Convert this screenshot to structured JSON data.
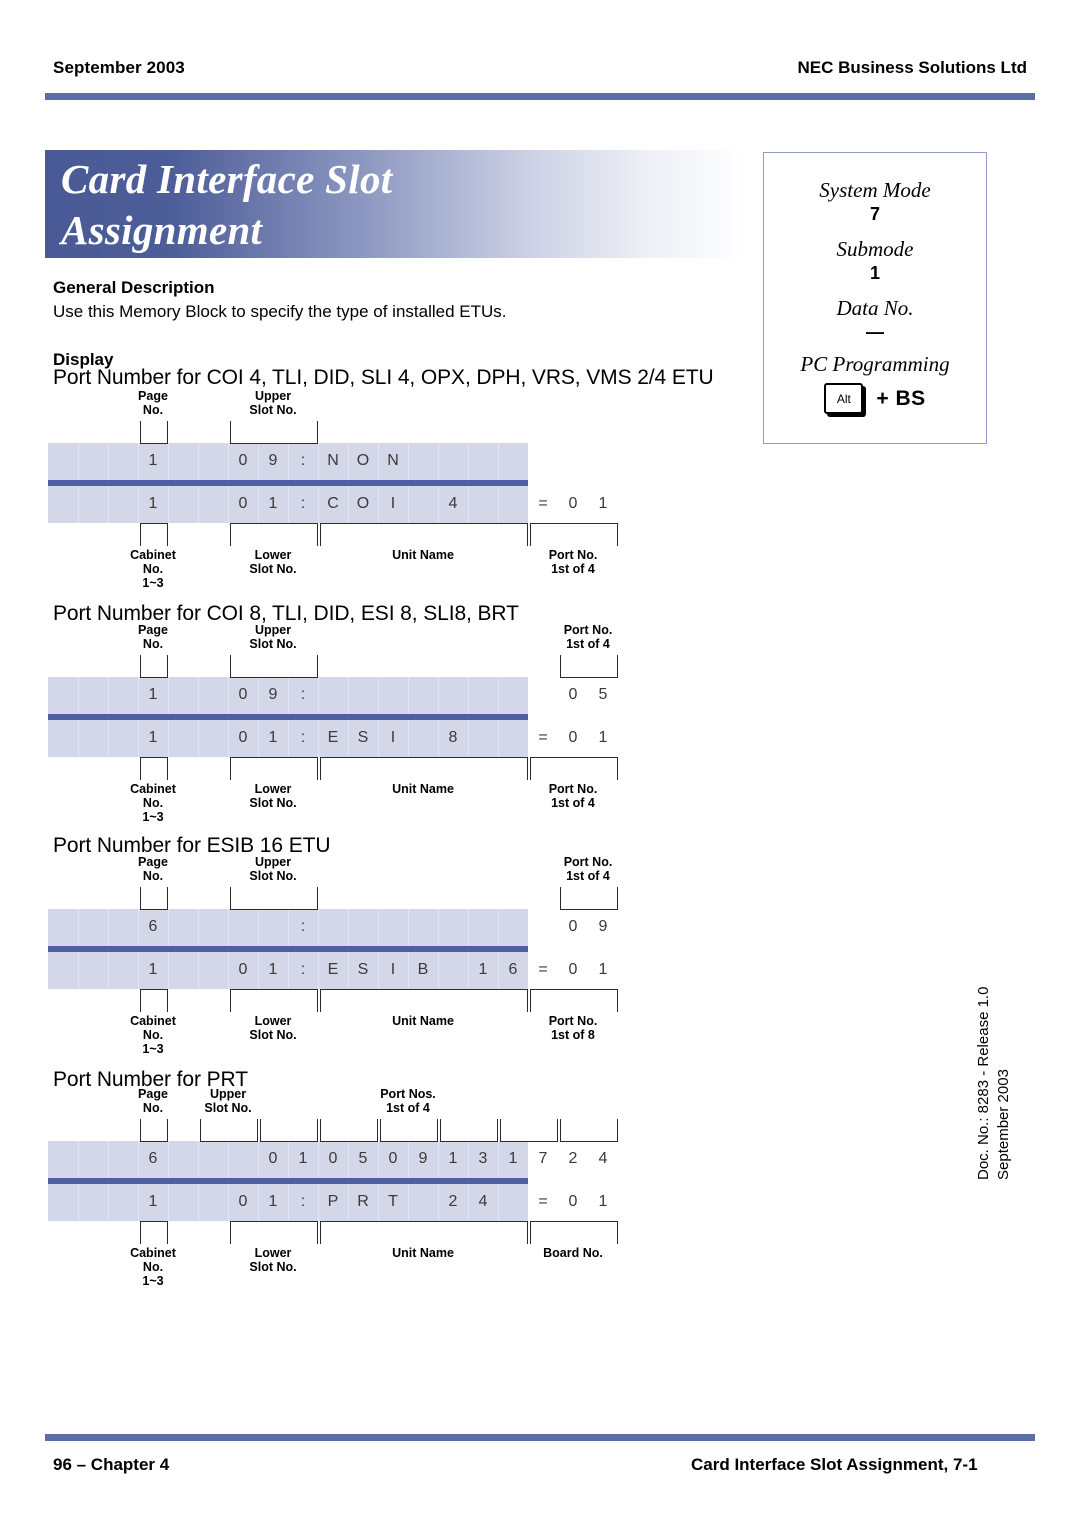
{
  "header": {
    "date": "September 2003",
    "company": "NEC Business Solutions Ltd"
  },
  "footer": {
    "left": "96 – Chapter 4",
    "right": "Card Interface Slot Assignment, 7-1"
  },
  "doc_sidebar": {
    "line1": "Doc. No.: 8283 - Release 1.0",
    "line2": "September 2003"
  },
  "title": {
    "line1": "Card Interface Slot",
    "line2": "Assignment"
  },
  "mode_box": {
    "system_mode_label": "System Mode",
    "system_mode_value": "7",
    "submode_label": "Submode",
    "submode_value": "1",
    "data_no_label": "Data No.",
    "data_no_value": "—",
    "pc_programming_label": "PC Programming",
    "key_label": "Alt",
    "key_combo": "+ BS"
  },
  "general": {
    "heading": "General Description",
    "text": "Use this Memory Block to specify the type of installed ETUs."
  },
  "display": {
    "heading": "Display"
  },
  "labels": {
    "page_no": "Page|No.",
    "upper_slot": "Upper|Slot No.",
    "port_no_1of4": "Port No.|1st of 4",
    "port_no_1of8": "Port No.|1st of 8",
    "port_nos_1of4": "Port Nos.|1st of 4",
    "cabinet_no": "Cabinet|No.|1~3",
    "lower_slot": "Lower|Slot No.",
    "unit_name": "Unit Name",
    "board_no": "Board No."
  },
  "sections": [
    {
      "title": "Port Number for COI 4, TLI, DID, SLI 4, OPX, DPH, VRS, VMS 2/4 ETU",
      "top_row": [
        {
          "c": 3,
          "t": "1"
        },
        {
          "c": 6,
          "t": "0"
        },
        {
          "c": 7,
          "t": "9"
        },
        {
          "c": 8,
          "t": ":"
        },
        {
          "c": 9,
          "t": "N"
        },
        {
          "c": 10,
          "t": "O"
        },
        {
          "c": 11,
          "t": "N"
        }
      ],
      "bottom_row": [
        {
          "c": 3,
          "t": "1"
        },
        {
          "c": 6,
          "t": "0"
        },
        {
          "c": 7,
          "t": "1"
        },
        {
          "c": 8,
          "t": ":"
        },
        {
          "c": 9,
          "t": "C"
        },
        {
          "c": 10,
          "t": "O"
        },
        {
          "c": 11,
          "t": "I"
        },
        {
          "c": 13,
          "t": "4"
        },
        {
          "c": 16,
          "t": "="
        },
        {
          "c": 17,
          "t": "0"
        },
        {
          "c": 18,
          "t": "1"
        }
      ]
    },
    {
      "title": "Port Number for COI 8, TLI, DID, ESI 8, SLI8, BRT",
      "top_row": [
        {
          "c": 3,
          "t": "1"
        },
        {
          "c": 6,
          "t": "0"
        },
        {
          "c": 7,
          "t": "9"
        },
        {
          "c": 8,
          "t": ":"
        },
        {
          "c": 17,
          "t": "0"
        },
        {
          "c": 18,
          "t": "5"
        }
      ],
      "bottom_row": [
        {
          "c": 3,
          "t": "1"
        },
        {
          "c": 6,
          "t": "0"
        },
        {
          "c": 7,
          "t": "1"
        },
        {
          "c": 8,
          "t": ":"
        },
        {
          "c": 9,
          "t": "E"
        },
        {
          "c": 10,
          "t": "S"
        },
        {
          "c": 11,
          "t": "I"
        },
        {
          "c": 13,
          "t": "8"
        },
        {
          "c": 16,
          "t": "="
        },
        {
          "c": 17,
          "t": "0"
        },
        {
          "c": 18,
          "t": "1"
        }
      ]
    },
    {
      "title": "Port Number for ESIB 16 ETU",
      "top_row": [
        {
          "c": 3,
          "t": "6"
        },
        {
          "c": 8,
          "t": ":"
        },
        {
          "c": 17,
          "t": "0"
        },
        {
          "c": 18,
          "t": "9"
        }
      ],
      "bottom_row": [
        {
          "c": 3,
          "t": "1"
        },
        {
          "c": 6,
          "t": "0"
        },
        {
          "c": 7,
          "t": "1"
        },
        {
          "c": 8,
          "t": ":"
        },
        {
          "c": 9,
          "t": "E"
        },
        {
          "c": 10,
          "t": "S"
        },
        {
          "c": 11,
          "t": "I"
        },
        {
          "c": 12,
          "t": "B"
        },
        {
          "c": 14,
          "t": "1"
        },
        {
          "c": 15,
          "t": "6"
        },
        {
          "c": 16,
          "t": "="
        },
        {
          "c": 17,
          "t": "0"
        },
        {
          "c": 18,
          "t": "1"
        }
      ]
    },
    {
      "title": "Port Number for PRT",
      "top_row": [
        {
          "c": 3,
          "t": "6"
        },
        {
          "c": 7,
          "t": "0"
        },
        {
          "c": 8,
          "t": "1"
        },
        {
          "c": 9,
          "t": "0"
        },
        {
          "c": 10,
          "t": "5"
        },
        {
          "c": 11,
          "t": "0"
        },
        {
          "c": 12,
          "t": "9"
        },
        {
          "c": 13,
          "t": "1"
        },
        {
          "c": 14,
          "t": "3"
        },
        {
          "c": 15,
          "t": "1"
        },
        {
          "c": 16,
          "t": "7"
        },
        {
          "c": 17,
          "t": "2"
        },
        {
          "c": 18,
          "t": "4"
        }
      ],
      "bottom_row": [
        {
          "c": 3,
          "t": "1"
        },
        {
          "c": 6,
          "t": "0"
        },
        {
          "c": 7,
          "t": "1"
        },
        {
          "c": 8,
          "t": ":"
        },
        {
          "c": 9,
          "t": "P"
        },
        {
          "c": 10,
          "t": "R"
        },
        {
          "c": 11,
          "t": "T"
        },
        {
          "c": 13,
          "t": "2"
        },
        {
          "c": 14,
          "t": "4"
        },
        {
          "c": 16,
          "t": "="
        },
        {
          "c": 17,
          "t": "0"
        },
        {
          "c": 18,
          "t": "1"
        }
      ]
    }
  ],
  "colors": {
    "rule": "#5b6ea8",
    "lcd_bg": "#d3d7e8",
    "lcd_divider": "#4e5fa6",
    "banner_start": "#4a5a96",
    "mode_border": "#8f9cc4"
  }
}
